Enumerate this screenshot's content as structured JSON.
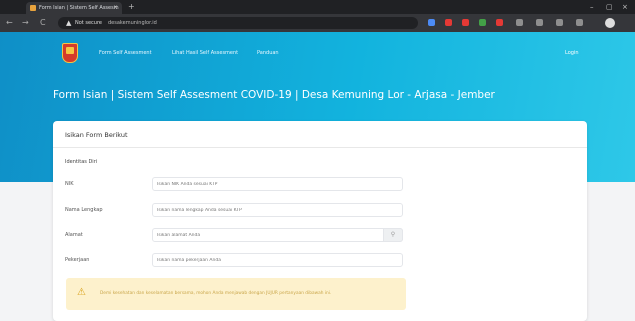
{
  "browser": {
    "tab_title": "Form Isian | Sistem Self Assesm",
    "tab_close": "×",
    "new_tab": "+",
    "window_buttons": [
      "–",
      "▢",
      "×"
    ],
    "nav": {
      "back": "←",
      "forward": "→",
      "reload": "C"
    },
    "security_label": "Not secure",
    "url": "desakemuninglor.id",
    "extension_colors": [
      "#4c8bf5",
      "#e53935",
      "#e53935",
      "#43a047",
      "#e53935",
      "#8e8e8e",
      "#8e8e8e",
      "#8e8e8e",
      "#8e8e8e"
    ]
  },
  "header": {
    "nav_links": [
      "Form Self Assesment",
      "Lihat Hasil Self Assesment",
      "Panduan"
    ],
    "login": "Login",
    "title": "Form Isian | Sistem Self Assesment COVID-19 | Desa Kemuning Lor - Arjasa - Jember",
    "gradient_colors": [
      "#0f8fc7",
      "#2ec8e8"
    ]
  },
  "form": {
    "card_title": "Isikan Form Berikut",
    "section_label": "Identitas Diri",
    "fields": [
      {
        "label": "NIK",
        "placeholder": "Isikan NIK Anda sesuai KTP"
      },
      {
        "label": "Nama Lengkap",
        "placeholder": "Isikan nama lengkap Anda sesuai KTP"
      },
      {
        "label": "Alamat",
        "placeholder": "Isikan alamat Anda"
      },
      {
        "label": "Pekerjaan",
        "placeholder": "Isikan nama pekerjaan Anda"
      }
    ],
    "alert": {
      "text": "Demi kesehatan dan keselamatan bersama, mohon Anda menjawab dengan JUJUR pertanyaan dibawah ini.",
      "color": "#fdf1cc"
    }
  }
}
